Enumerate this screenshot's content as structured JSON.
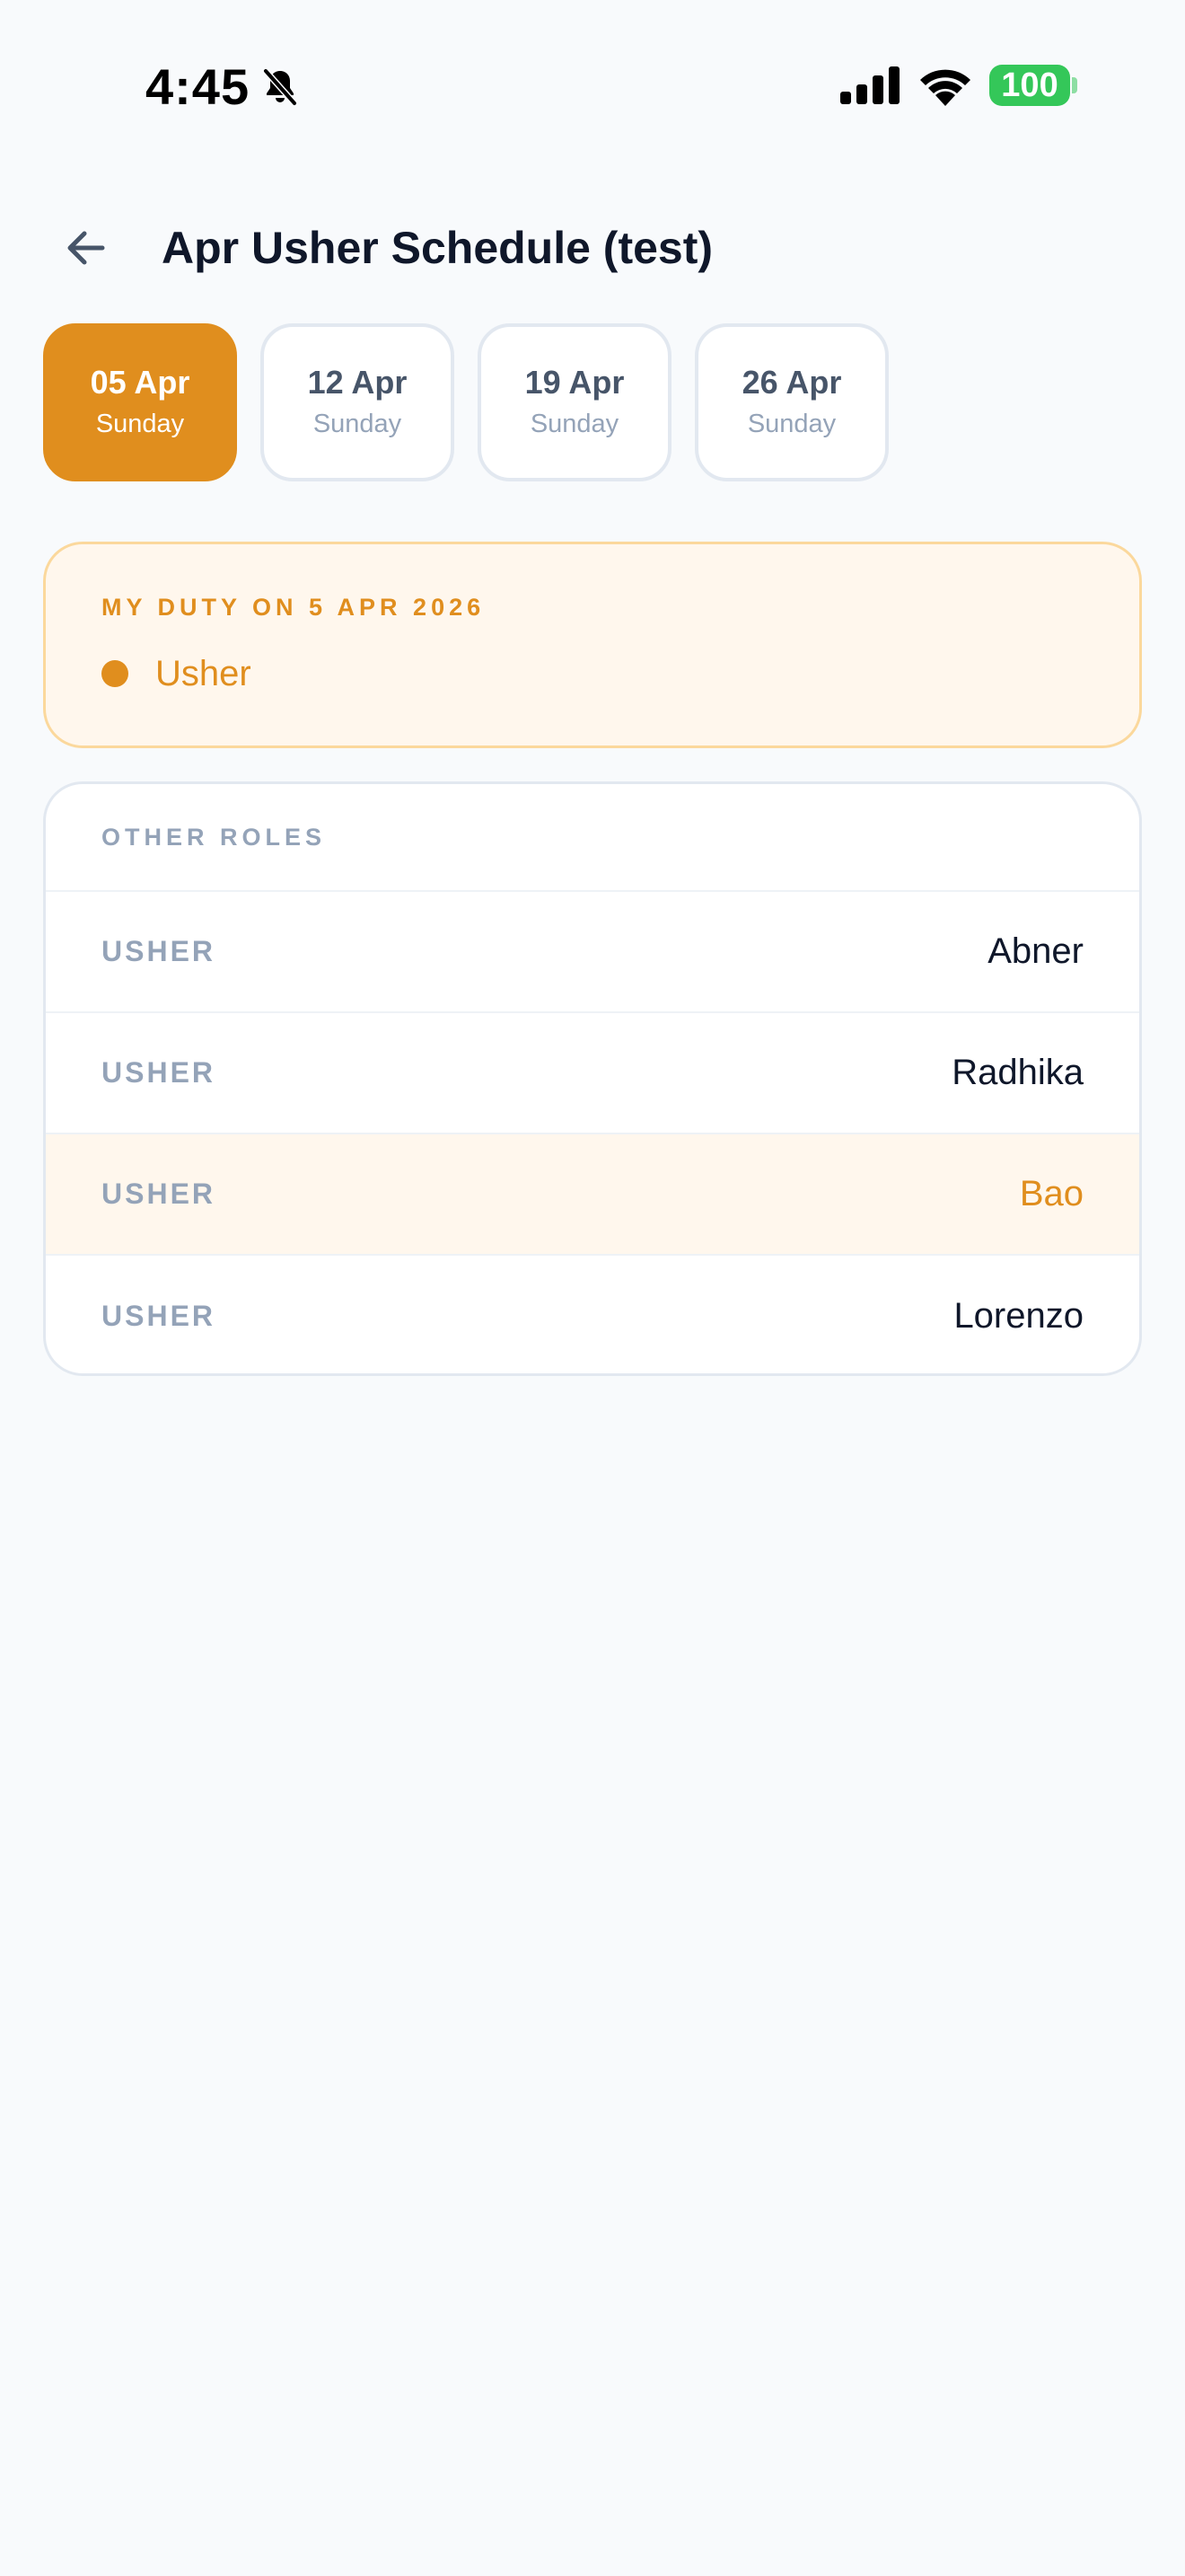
{
  "status_bar": {
    "time": "4:45",
    "battery": "100",
    "icons": [
      "bell-slash-icon",
      "cellular-signal-icon",
      "wifi-icon",
      "battery-icon"
    ]
  },
  "header": {
    "back_icon": "arrow-left-icon",
    "title": "Apr Usher Schedule (test)"
  },
  "dates": [
    {
      "day": "05 Apr",
      "weekday": "Sunday",
      "selected": true
    },
    {
      "day": "12 Apr",
      "weekday": "Sunday",
      "selected": false
    },
    {
      "day": "19 Apr",
      "weekday": "Sunday",
      "selected": false
    },
    {
      "day": "26 Apr",
      "weekday": "Sunday",
      "selected": false
    }
  ],
  "my_duty": {
    "heading": "MY DUTY ON 5 APR 2026",
    "role": "Usher"
  },
  "other_roles": {
    "heading": "OTHER ROLES",
    "rows": [
      {
        "role": "USHER",
        "name": "Abner",
        "highlighted": false
      },
      {
        "role": "USHER",
        "name": "Radhika",
        "highlighted": false
      },
      {
        "role": "USHER",
        "name": "Bao",
        "highlighted": true
      },
      {
        "role": "USHER",
        "name": "Lorenzo",
        "highlighted": false
      }
    ]
  },
  "colors": {
    "accent": "#e08e1e",
    "accent_soft": "#fff7ed",
    "accent_border": "#fbd89c",
    "text_primary": "#0f172a",
    "text_muted": "#94a3b8",
    "background": "#f8fafc",
    "battery_green": "#34c759"
  }
}
